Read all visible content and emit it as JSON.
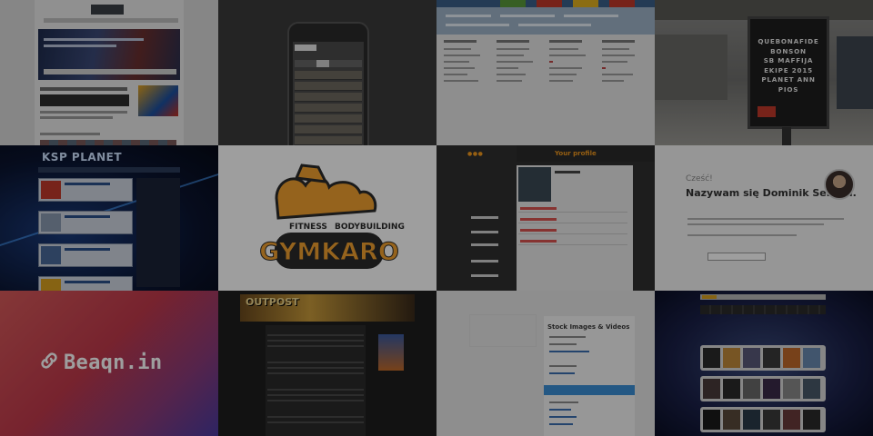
{
  "tiles": {
    "blog": {},
    "phone": {},
    "portal": {},
    "billboard": {
      "poster_lines": [
        "QUEBONAFIDE",
        "BONSON",
        "SB MAFFIJA",
        "EKIPE 2015",
        "PLANET ANN",
        "PIOS"
      ]
    },
    "ksp": {
      "title": "KSP PLANET"
    },
    "gym": {
      "word_left": "FITNESS",
      "word_right": "BODYBUILDING",
      "brand": "GYMKARO",
      "colors": {
        "orange": "#f0a030",
        "dark": "#2a2a2a"
      }
    },
    "profile": {
      "header": "Your profile"
    },
    "personal": {
      "greeting": "Cześć!",
      "headline": "Nazywam się Dominik Serafin."
    },
    "beaqn": {
      "brand": "Beaqn.in",
      "link_icon": "link-icon"
    },
    "outpost": {
      "banner": "OUTPOST"
    },
    "stock": {
      "heading": "Stock Images & Videos"
    },
    "albums": {}
  }
}
